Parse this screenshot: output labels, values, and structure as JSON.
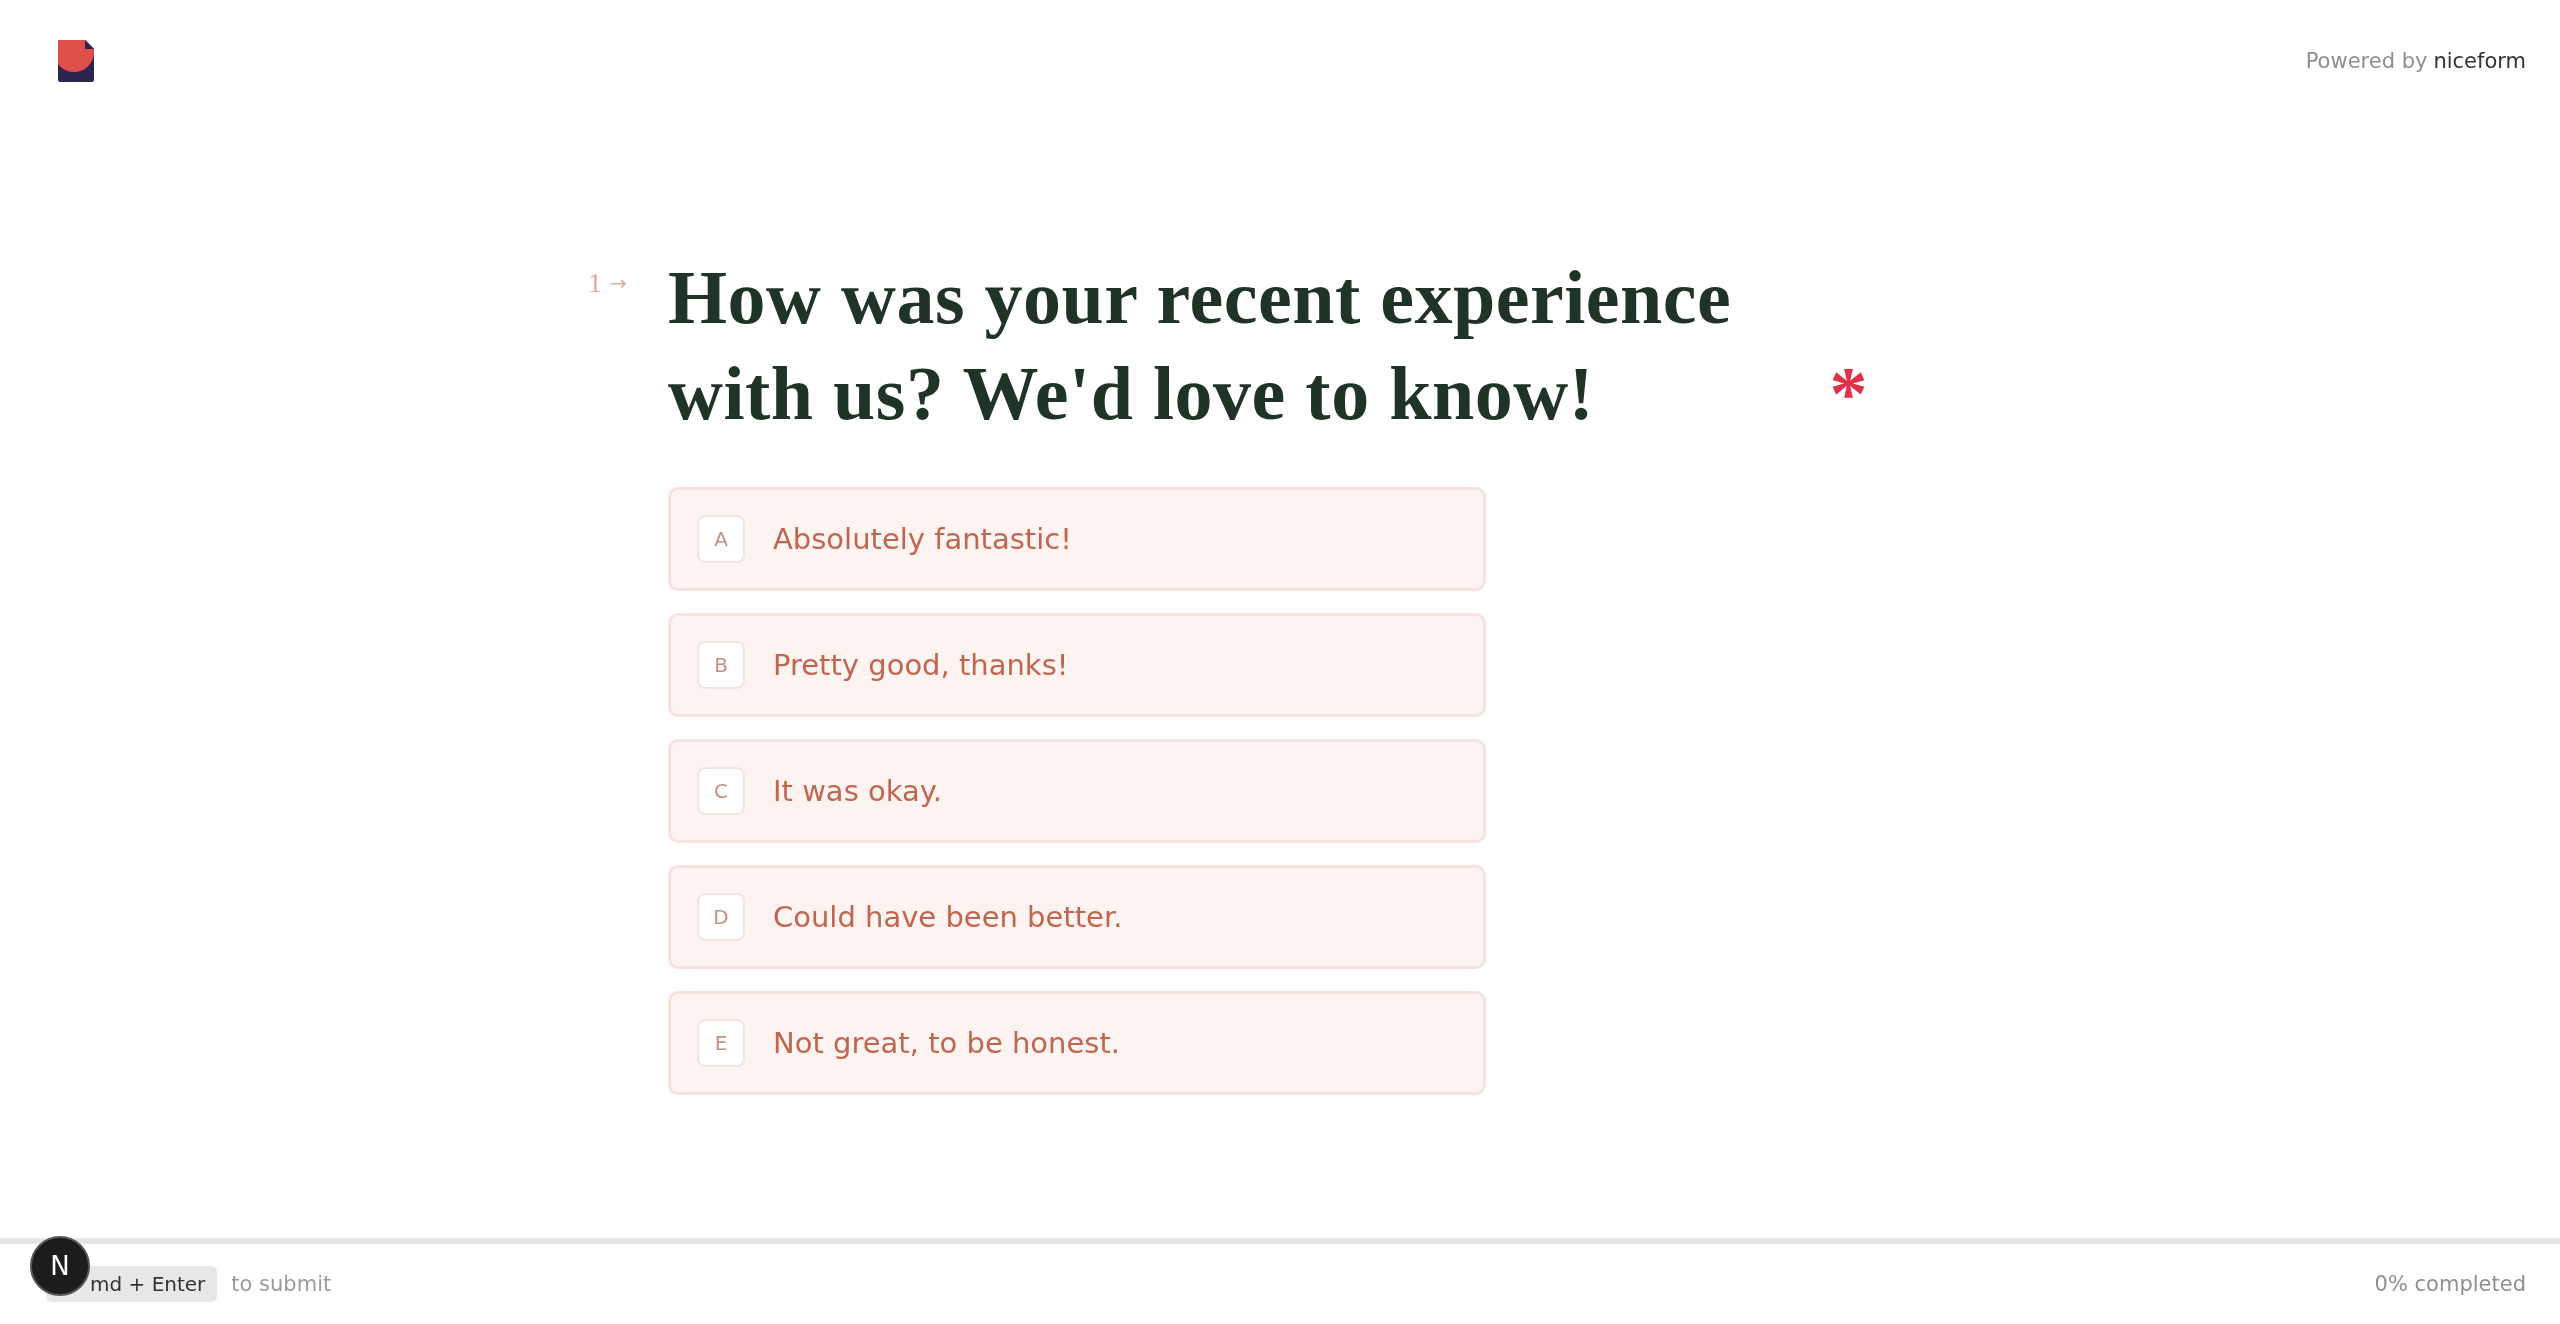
{
  "header": {
    "powered_by": "Powered by",
    "brand": "niceform"
  },
  "question": {
    "number": "1",
    "arrow": "→",
    "title": "How was your recent experience with us? We'd love to know!",
    "required_mark": "*",
    "options": [
      {
        "key": "A",
        "label": "Absolutely fantastic!",
        "selected": false
      },
      {
        "key": "B",
        "label": "Pretty good, thanks!",
        "selected": false
      },
      {
        "key": "C",
        "label": "It was okay.",
        "selected": false
      },
      {
        "key": "D",
        "label": "Could have been better.",
        "selected": false
      },
      {
        "key": "E",
        "label": "Not great, to be honest.",
        "selected": false
      }
    ]
  },
  "footer": {
    "shortcut": "md + Enter",
    "hint": "to submit",
    "completion": "0% completed",
    "badge": "N"
  }
}
